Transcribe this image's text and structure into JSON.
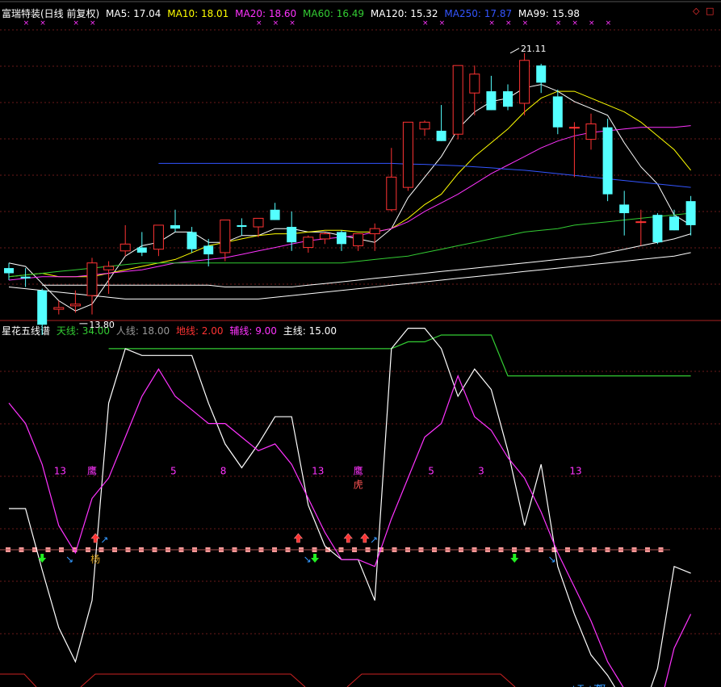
{
  "header": {
    "title": "富瑞特装(日线 前复权)",
    "ma": [
      {
        "label": "MA5: 17.04",
        "color": "#ffffff"
      },
      {
        "label": "MA10: 18.01",
        "color": "#ffff00"
      },
      {
        "label": "MA20: 18.60",
        "color": "#ff33ff"
      },
      {
        "label": "MA60: 16.49",
        "color": "#33cc33"
      },
      {
        "label": "MA120: 15.32",
        "color": "#ffffff"
      },
      {
        "label": "MA250: 17.87",
        "color": "#3355ff"
      },
      {
        "label": "MA99: 15.98",
        "color": "#ffffff"
      }
    ],
    "corner_icons": [
      "diamond-icon",
      "square-icon"
    ]
  },
  "sub_header": {
    "title": "星花五线谱",
    "items": [
      {
        "label": "天线: 34.00",
        "color": "#33cc33"
      },
      {
        "label": "人线: 18.00",
        "color": "#999999"
      },
      {
        "label": "地线: 2.00",
        "color": "#ff3333"
      },
      {
        "label": "辅线: 9.00",
        "color": "#ff33ff"
      },
      {
        "label": "主线: 15.00",
        "color": "#ffffff"
      }
    ]
  },
  "chart_data": [
    {
      "type": "candlestick",
      "title": "富瑞特装(日线 前复权)",
      "ylim": [
        13.3,
        22.0
      ],
      "annotations": [
        {
          "text": "21.11",
          "x": 30
        },
        {
          "text": "13.80",
          "x": 4
        }
      ],
      "candles": [
        [
          14.85,
          15.0,
          14.5,
          14.7
        ],
        [
          14.6,
          14.85,
          14.3,
          14.55
        ],
        [
          14.2,
          14.25,
          12.9,
          13.2
        ],
        [
          13.65,
          13.9,
          13.5,
          13.7
        ],
        [
          13.75,
          14.2,
          13.55,
          13.8
        ],
        [
          14.05,
          15.15,
          13.5,
          15.0
        ],
        [
          14.8,
          15.05,
          14.1,
          14.9
        ],
        [
          15.35,
          16.1,
          15.2,
          15.55
        ],
        [
          15.45,
          15.9,
          15.2,
          15.3
        ],
        [
          15.4,
          16.1,
          15.2,
          16.1
        ],
        [
          16.1,
          16.55,
          15.9,
          16.0
        ],
        [
          15.9,
          16.05,
          15.3,
          15.4
        ],
        [
          15.5,
          15.7,
          14.9,
          15.25
        ],
        [
          15.3,
          16.25,
          15.05,
          16.25
        ],
        [
          16.1,
          16.3,
          15.8,
          16.05
        ],
        [
          16.05,
          16.3,
          15.75,
          16.3
        ],
        [
          16.55,
          16.75,
          16.25,
          16.25
        ],
        [
          16.05,
          16.5,
          15.35,
          15.6
        ],
        [
          15.45,
          15.8,
          15.3,
          15.75
        ],
        [
          15.7,
          15.9,
          15.55,
          15.85
        ],
        [
          15.9,
          15.95,
          15.35,
          15.55
        ],
        [
          15.5,
          15.85,
          15.35,
          15.85
        ],
        [
          15.85,
          16.15,
          15.35,
          16.0
        ],
        [
          16.55,
          18.35,
          16.5,
          17.5
        ],
        [
          17.2,
          19.1,
          17.1,
          19.1
        ],
        [
          18.9,
          19.15,
          18.7,
          19.1
        ],
        [
          18.85,
          19.6,
          18.55,
          18.55
        ],
        [
          18.75,
          19.45,
          18.6,
          20.75
        ],
        [
          19.95,
          20.75,
          19.3,
          20.5
        ],
        [
          20.0,
          20.45,
          19.45,
          19.45
        ],
        [
          20.0,
          20.2,
          19.45,
          19.55
        ],
        [
          19.65,
          21.11,
          19.3,
          20.9
        ],
        [
          20.75,
          20.8,
          19.95,
          20.25
        ],
        [
          19.85,
          20.05,
          18.75,
          18.95
        ],
        [
          18.95,
          19.1,
          17.5,
          18.95
        ],
        [
          18.6,
          19.35,
          18.3,
          19.05
        ],
        [
          18.95,
          19.2,
          16.8,
          17.0
        ],
        [
          16.7,
          17.1,
          15.8,
          16.45
        ],
        [
          16.2,
          16.55,
          15.5,
          16.2
        ],
        [
          16.4,
          16.45,
          15.55,
          15.6
        ],
        [
          16.35,
          16.55,
          15.95,
          15.95
        ],
        [
          16.8,
          16.95,
          15.8,
          16.1
        ]
      ],
      "series": [
        {
          "name": "MA5",
          "color": "#ffffff",
          "values": [
            15.0,
            14.9,
            14.4,
            13.9,
            13.6,
            13.8,
            14.5,
            15.2,
            15.5,
            15.6,
            15.9,
            15.9,
            15.6,
            15.6,
            15.8,
            15.8,
            16.0,
            16.0,
            15.9,
            15.9,
            15.8,
            15.7,
            15.6,
            16.0,
            16.9,
            17.5,
            18.1,
            18.9,
            19.4,
            19.7,
            19.8,
            20.1,
            20.2,
            20.0,
            19.7,
            19.5,
            19.3,
            18.5,
            17.8,
            17.3,
            16.4,
            16.1
          ]
        },
        {
          "name": "MA10",
          "color": "#ffff00",
          "values": [
            14.6,
            14.65,
            14.7,
            14.6,
            14.6,
            14.6,
            14.7,
            14.8,
            14.9,
            15.0,
            15.1,
            15.3,
            15.5,
            15.6,
            15.7,
            15.8,
            15.85,
            15.85,
            15.9,
            15.95,
            15.95,
            15.9,
            15.9,
            16.0,
            16.3,
            16.7,
            17.0,
            17.6,
            18.1,
            18.5,
            18.9,
            19.4,
            19.8,
            20.0,
            20.0,
            19.8,
            19.6,
            19.4,
            19.1,
            18.7,
            18.3,
            17.7
          ]
        },
        {
          "name": "MA20",
          "color": "#ff33ff",
          "values": [
            14.5,
            14.55,
            14.6,
            14.6,
            14.6,
            14.65,
            14.7,
            14.75,
            14.8,
            14.9,
            15.0,
            15.05,
            15.1,
            15.15,
            15.25,
            15.35,
            15.45,
            15.55,
            15.65,
            15.7,
            15.75,
            15.8,
            15.9,
            16.0,
            16.2,
            16.5,
            16.75,
            17.0,
            17.3,
            17.6,
            17.85,
            18.1,
            18.35,
            18.55,
            18.7,
            18.8,
            18.85,
            18.9,
            18.95,
            18.95,
            18.95,
            19.0
          ]
        },
        {
          "name": "MA60",
          "color": "#33cc33",
          "values": [
            14.6,
            14.65,
            14.7,
            14.75,
            14.8,
            14.85,
            14.9,
            14.95,
            15.0,
            15.0,
            15.0,
            15.0,
            15.0,
            15.0,
            15.0,
            15.0,
            15.0,
            15.0,
            15.0,
            15.0,
            15.0,
            15.05,
            15.1,
            15.15,
            15.2,
            15.3,
            15.4,
            15.5,
            15.6,
            15.7,
            15.8,
            15.9,
            15.95,
            16.0,
            16.1,
            16.15,
            16.2,
            16.25,
            16.3,
            16.35,
            16.4,
            16.45
          ]
        },
        {
          "name": "MA120",
          "color": "#ffffff",
          "values": [
            14.3,
            14.25,
            14.2,
            14.15,
            14.1,
            14.05,
            14.0,
            13.95,
            13.95,
            13.95,
            13.95,
            13.95,
            13.95,
            13.95,
            13.95,
            13.95,
            14.0,
            14.05,
            14.1,
            14.15,
            14.2,
            14.25,
            14.3,
            14.35,
            14.4,
            14.45,
            14.5,
            14.55,
            14.6,
            14.65,
            14.7,
            14.75,
            14.8,
            14.85,
            14.9,
            14.95,
            15.0,
            15.05,
            15.1,
            15.15,
            15.2,
            15.3
          ]
        },
        {
          "name": "MA99",
          "color": "#ffffff",
          "values": [
            null,
            null,
            14.35,
            14.35,
            14.35,
            14.35,
            14.35,
            14.35,
            14.35,
            14.35,
            14.35,
            14.35,
            14.35,
            14.3,
            14.3,
            14.3,
            14.3,
            14.3,
            14.35,
            14.4,
            14.45,
            14.5,
            14.55,
            14.6,
            14.65,
            14.7,
            14.75,
            14.8,
            14.85,
            14.9,
            14.95,
            15.0,
            15.05,
            15.1,
            15.15,
            15.2,
            15.3,
            15.4,
            15.5,
            15.6,
            15.7,
            15.85
          ]
        },
        {
          "name": "MA250",
          "color": "#3355ff",
          "values": [
            null,
            null,
            null,
            null,
            null,
            null,
            null,
            null,
            null,
            17.9,
            17.9,
            17.9,
            17.9,
            17.9,
            17.9,
            17.9,
            17.9,
            17.9,
            17.9,
            17.9,
            17.9,
            17.9,
            17.9,
            17.9,
            17.88,
            17.87,
            17.85,
            17.83,
            17.8,
            17.77,
            17.73,
            17.7,
            17.65,
            17.6,
            17.55,
            17.5,
            17.45,
            17.4,
            17.35,
            17.3,
            17.25,
            17.2
          ]
        }
      ]
    },
    {
      "type": "line",
      "title": "星花五线谱",
      "ylim": [
        -15,
        36
      ],
      "series": [
        {
          "name": "天线",
          "color": "#33cc33",
          "values": [
            null,
            null,
            null,
            null,
            null,
            null,
            34,
            34,
            34,
            34,
            34,
            34,
            34,
            34,
            34,
            34,
            34,
            34,
            34,
            34,
            34,
            34,
            34,
            34,
            35,
            35,
            36,
            36,
            36,
            36,
            30,
            30,
            30,
            30,
            30,
            30,
            30,
            30,
            30,
            30,
            30,
            30
          ]
        },
        {
          "name": "主线",
          "color": "#ffffff",
          "values": [
            10.5,
            10.5,
            1.5,
            -7,
            -12,
            -3,
            26,
            34,
            33,
            33,
            33,
            33,
            26,
            20,
            16.5,
            20,
            24,
            24,
            11,
            5,
            3,
            3,
            -3,
            34,
            37,
            37,
            34,
            27,
            31,
            28,
            19,
            8,
            17,
            2,
            -5,
            -11,
            -14,
            -18,
            -20,
            -13,
            2,
            1
          ]
        },
        {
          "name": "辅线",
          "color": "#ff33ff",
          "values": [
            26,
            23,
            17,
            8,
            4,
            12,
            15,
            21,
            27,
            31,
            27,
            25,
            23,
            23,
            21,
            19,
            20,
            17,
            12,
            7,
            3,
            3,
            2,
            9,
            15,
            21,
            23,
            30,
            24,
            22,
            18,
            15,
            10,
            4,
            -1,
            -6,
            -12,
            -16,
            -20,
            -20,
            -10,
            -5
          ]
        }
      ],
      "labels": [
        {
          "text": "13",
          "x": 3,
          "y": 16
        },
        {
          "text": "鹰",
          "x": 5,
          "y": 16
        },
        {
          "text": "5",
          "x": 10,
          "y": 16
        },
        {
          "text": "8",
          "x": 13,
          "y": 16
        },
        {
          "text": "13",
          "x": 18.5,
          "y": 16
        },
        {
          "text": "鹰",
          "x": 21,
          "y": 16
        },
        {
          "text": "虎",
          "x": 21,
          "y": 14
        },
        {
          "text": "5",
          "x": 25.5,
          "y": 16
        },
        {
          "text": "3",
          "x": 28.5,
          "y": 16
        },
        {
          "text": "13",
          "x": 34,
          "y": 16
        },
        {
          "text": "杨",
          "x": 5.2,
          "y": 3
        },
        {
          "text": "+T",
          "x": 34,
          "y": -16
        },
        {
          "text": "+T",
          "x": 35,
          "y": -16
        },
        {
          "text": "饵",
          "x": 35.6,
          "y": -16
        }
      ]
    }
  ]
}
